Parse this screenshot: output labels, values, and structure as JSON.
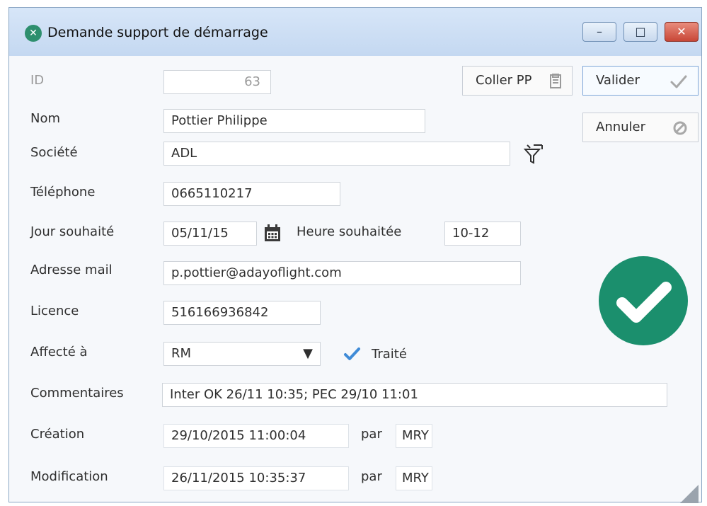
{
  "window": {
    "title": "Demande support de démarrage",
    "controls": [
      "minimize",
      "maximize",
      "close"
    ]
  },
  "buttons": {
    "coller_pp": "Coller PP",
    "valider": "Valider",
    "annuler": "Annuler"
  },
  "fields": {
    "id": {
      "label": "ID",
      "value": "63"
    },
    "nom": {
      "label": "Nom",
      "value": "Pottier Philippe"
    },
    "societe": {
      "label": "Société",
      "value": "ADL"
    },
    "telephone": {
      "label": "Téléphone",
      "value": "0665110217"
    },
    "jour_souhaite": {
      "label": "Jour souhaité",
      "value": "05/11/15"
    },
    "heure_souhaitee": {
      "label": "Heure souhaitée",
      "value": "10-12"
    },
    "adresse_mail": {
      "label": "Adresse mail",
      "value": "p.pottier@adayoflight.com"
    },
    "licence": {
      "label": "Licence",
      "value": "516166936842"
    },
    "affecte_a": {
      "label": "Affecté à",
      "value": "RM"
    },
    "traite": {
      "label": "Traité",
      "checked": true
    },
    "commentaires": {
      "label": "Commentaires",
      "value": "Inter OK 26/11 10:35; PEC 29/10 11:01"
    },
    "creation": {
      "label": "Création",
      "value": "29/10/2015 11:00:04",
      "par_label": "par",
      "par_value": "MRY"
    },
    "modification": {
      "label": "Modification",
      "value": "26/11/2015 10:35:37",
      "par_label": "par",
      "par_value": "MRY"
    }
  },
  "icons": {
    "app": "tools-icon",
    "coller_pp": "clipboard-icon",
    "valider": "checkmark-icon",
    "annuler": "prohibited-icon",
    "filter": "filter-icon",
    "calendar": "calendar-icon",
    "status": "status-check-icon",
    "resize": "resize-grip-icon"
  },
  "colors": {
    "titlebar": "#c4d8f1",
    "status_ok": "#1b8f6d",
    "check": "#3f8bd7"
  }
}
